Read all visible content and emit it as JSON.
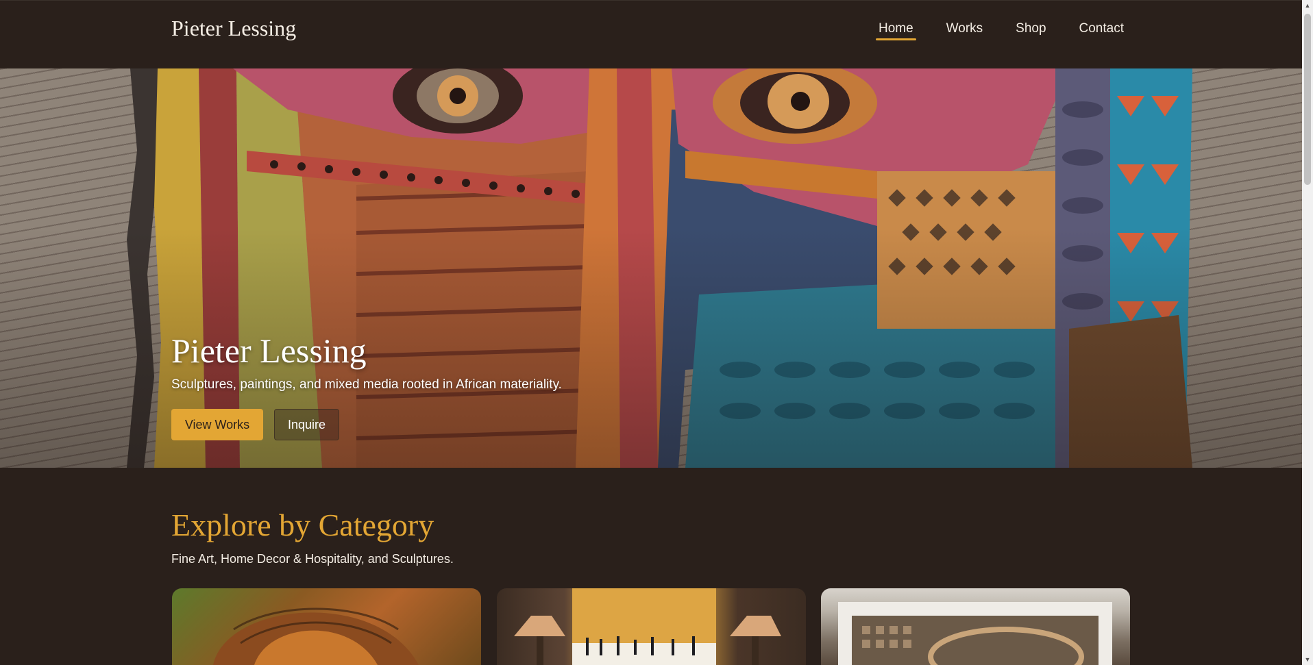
{
  "header": {
    "brand": "Pieter Lessing",
    "nav": [
      {
        "label": "Home",
        "active": true
      },
      {
        "label": "Works",
        "active": false
      },
      {
        "label": "Shop",
        "active": false
      },
      {
        "label": "Contact",
        "active": false
      }
    ]
  },
  "hero": {
    "title": "Pieter Lessing",
    "subtitle": "Sculptures, paintings, and mixed media rooted in African materiality.",
    "primary_button": "View Works",
    "secondary_button": "Inquire"
  },
  "categories": {
    "title": "Explore by Category",
    "subtitle": "Fine Art, Home Decor & Hospitality, and Sculptures."
  },
  "colors": {
    "accent": "#e3a634",
    "background": "#2a201b",
    "text": "#f4ede4"
  }
}
